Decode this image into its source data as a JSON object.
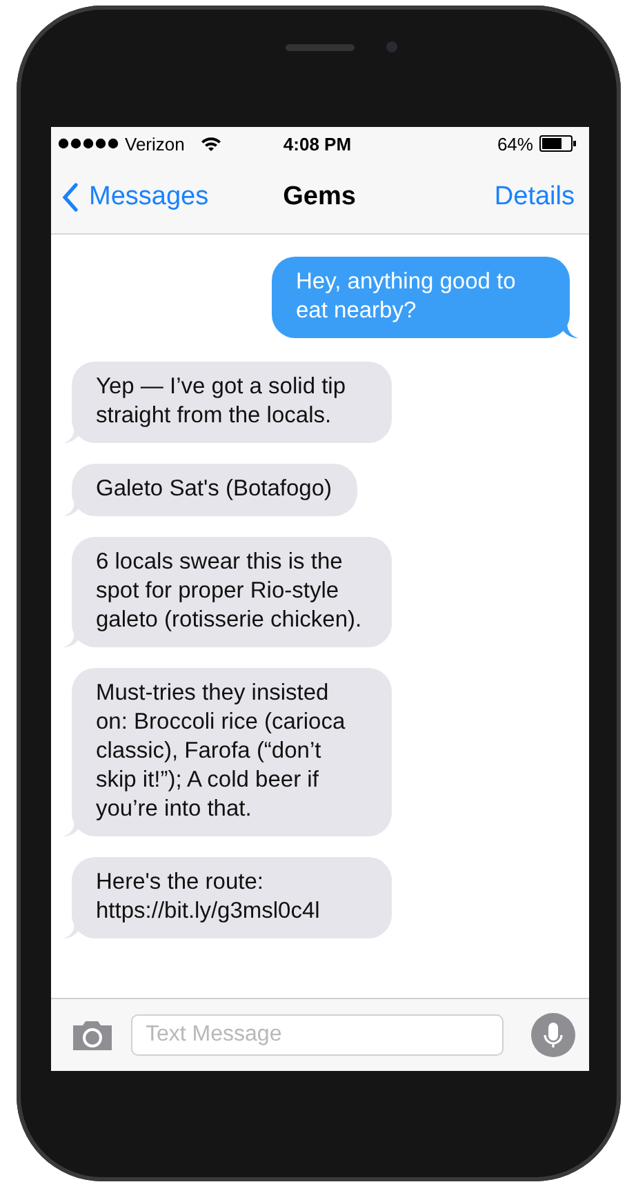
{
  "status_bar": {
    "carrier": "Verizon",
    "time": "4:08 PM",
    "battery": "64%"
  },
  "nav": {
    "back": "Messages",
    "title": "Gems",
    "action": "Details"
  },
  "messages": [
    {
      "kind": "sent",
      "text": "Hey, anything good to eat nearby?"
    },
    {
      "kind": "received",
      "text": "Yep — I’ve got a solid tip straight from the locals."
    },
    {
      "kind": "received",
      "text": "Galeto Sat's (Botafogo)"
    },
    {
      "kind": "received",
      "text": "6 locals swear this is the spot for proper Rio-style galeto (rotisserie chicken)."
    },
    {
      "kind": "received",
      "text": "Must-tries they insisted on: Broccoli rice (carioca classic), Farofa (“don’t skip it!”); A cold beer if you’re into that."
    },
    {
      "kind": "received",
      "text": "Here's the route: https://bit.ly/g3msl0c4l"
    }
  ],
  "composer": {
    "placeholder": "Text Message"
  }
}
